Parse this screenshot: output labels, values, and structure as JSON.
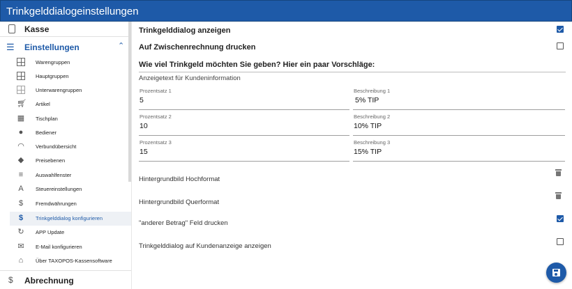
{
  "window": {
    "title": "Trinkgelddialogeinstellungen"
  },
  "sidebar": {
    "top_item": {
      "label": "Kasse",
      "icon": "phone-icon"
    },
    "section": {
      "label": "Einstellungen",
      "icon": "settings-list-icon"
    },
    "items": [
      {
        "label": "Warengruppen",
        "icon": "grid-icon"
      },
      {
        "label": "Hauptgruppen",
        "icon": "grid-icon"
      },
      {
        "label": "Unterwarengruppen",
        "icon": "grid-icon"
      },
      {
        "label": "Artikel",
        "icon": "cart-icon"
      },
      {
        "label": "Tischplan",
        "icon": "table-grid-icon"
      },
      {
        "label": "Bediener",
        "icon": "person-icon"
      },
      {
        "label": "Verbundübersicht",
        "icon": "wifi-icon"
      },
      {
        "label": "Preisebenen",
        "icon": "layers-icon"
      },
      {
        "label": "Auswahlfenster",
        "icon": "menu-icon"
      },
      {
        "label": "Steuereinstellungen",
        "icon": "tax-icon"
      },
      {
        "label": "Fremdwährungen",
        "icon": "currency-exchange-icon"
      },
      {
        "label": "Trinkgelddialog konfigurieren",
        "icon": "dollar-icon",
        "active": true
      },
      {
        "label": "APP Update",
        "icon": "update-icon"
      },
      {
        "label": "E-Mail konfigurieren",
        "icon": "mail-icon"
      },
      {
        "label": "Über TAXOPOS-Kassensoftware",
        "icon": "bank-icon"
      }
    ],
    "bottom_item": {
      "label": "Abrechnung",
      "icon": "dollar-icon"
    }
  },
  "main": {
    "show_dialog": {
      "label": "Trinkgelddialog anzeigen",
      "checked": true
    },
    "print_interim": {
      "label": "Auf Zwischenrechnung drucken",
      "checked": false
    },
    "question": "Wie viel Trinkgeld möchten Sie geben? Hier ein paar Vorschläge:",
    "info_label": "Anzeigetext für Kundeninformation",
    "fields": [
      {
        "pct_label": "Prozentsatz 1",
        "pct_value": "5",
        "desc_label": "Beschreibung 1",
        "desc_value": "5% TIP"
      },
      {
        "pct_label": "Prozentsatz 2",
        "pct_value": "10",
        "desc_label": "Beschreibung 2",
        "desc_value": "10% TIP"
      },
      {
        "pct_label": "Prozentsatz 3",
        "pct_value": "15",
        "desc_label": "Beschreibung 3",
        "desc_value": "15% TIP"
      }
    ],
    "bg_portrait": {
      "label": "Hintergrundbild Hochformat"
    },
    "bg_landscape": {
      "label": "Hintergrundbild Querformat"
    },
    "other_amount": {
      "label": "\"anderer Betrag\" Feld drucken",
      "checked": true
    },
    "customer_display": {
      "label": "Trinkgelddialog auf Kundenanzeige anzeigen",
      "checked": false
    },
    "save_icon": "save-icon"
  },
  "colors": {
    "accent": "#1e5aa8"
  }
}
